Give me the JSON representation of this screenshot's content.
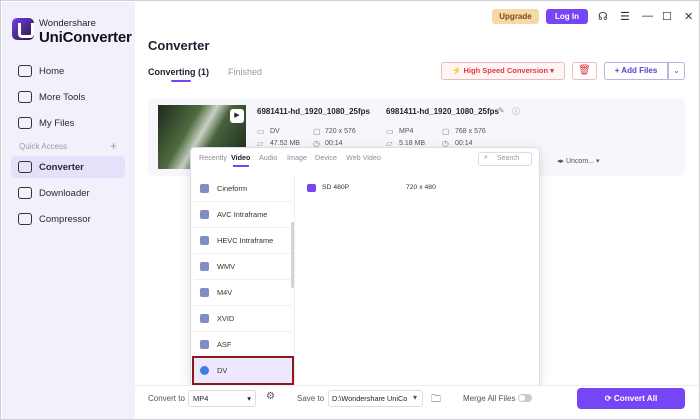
{
  "app": {
    "brand_top": "Wondershare",
    "brand_main": "UniConverter"
  },
  "sidebar": {
    "items": [
      {
        "label": "Home",
        "icon": "home-icon"
      },
      {
        "label": "More Tools",
        "icon": "toolbox-icon"
      },
      {
        "label": "My Files",
        "icon": "files-icon"
      },
      {
        "label": "Converter",
        "icon": "converter-icon"
      },
      {
        "label": "Downloader",
        "icon": "downloader-icon"
      },
      {
        "label": "Compressor",
        "icon": "compressor-icon"
      }
    ],
    "quick_access": "Quick Access",
    "quick_plus": "+"
  },
  "header": {
    "upgrade": "Upgrade",
    "login": "Log In",
    "title": "Converter",
    "tab_converting": "Converting (1)",
    "tab_finished": "Finished",
    "high_speed": "High Speed Conversion",
    "add_files": "Add Files"
  },
  "file": {
    "src_name": "6981411-hd_1920_1080_25fps",
    "src_fmt": "DV",
    "src_res": "720 x 576",
    "src_size": "47.52 MB",
    "src_dur": "00:14",
    "dst_name": "6981411-hd_1920_1080_25fps",
    "dst_fmt": "MP4",
    "dst_res": "768 x 576",
    "dst_size": "5.18 MB",
    "dst_dur": "00:14",
    "quality": "Uncom..."
  },
  "format_panel": {
    "tabs": [
      "Recently",
      "Video",
      "Audio",
      "Image",
      "Device",
      "Web Video"
    ],
    "active_tab": "Video",
    "search_placeholder": "Search",
    "formats": [
      "Cineform",
      "AVC Intraframe",
      "HEVC Intraframe",
      "WMV",
      "M4V",
      "XVID",
      "ASF",
      "DV"
    ],
    "selected": "DV",
    "resolutions": [
      {
        "name": "SD 480P",
        "value": "720 x 480"
      }
    ]
  },
  "bottom": {
    "convert_to_label": "Convert to",
    "convert_to_value": "MP4",
    "save_to_label": "Save to",
    "save_to_value": "D:\\Wondershare UniCo",
    "merge": "Merge All Files",
    "convert_all": "Convert All"
  },
  "colors": {
    "accent": "#7645f5",
    "danger": "#e0383e",
    "selection_outline": "#8c1a1a"
  }
}
